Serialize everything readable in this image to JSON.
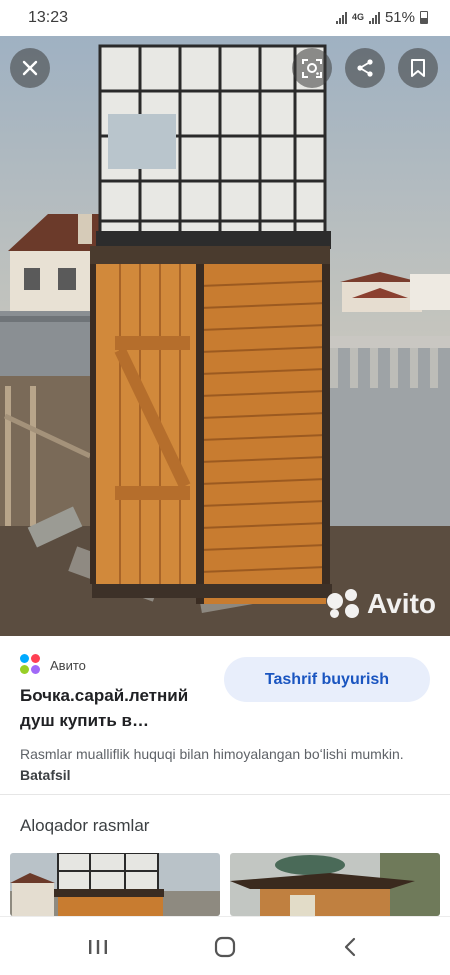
{
  "status": {
    "time": "13:23",
    "network": "4G",
    "battery": "51%"
  },
  "hero": {
    "watermark": "Avito",
    "buttons": {
      "close": "close-icon",
      "lens": "lens-icon",
      "share": "share-icon",
      "bookmark": "bookmark-icon"
    }
  },
  "result": {
    "source": "Авито",
    "title": "Бочка.сарай.летний душ купить в…",
    "visit_label": "Tashrif buyurish",
    "copyright_text": "Rasmlar mualliflik huquqi bilan himoyalangan boʻlishi mumkin.",
    "more_link": "Batafsil"
  },
  "related": {
    "heading": "Aloqador rasmlar"
  },
  "navbar": {
    "recents": "recents-icon",
    "home": "home-icon",
    "back": "back-icon"
  },
  "colors": {
    "accent": "#1a55c0",
    "button_bg": "#e8eefb",
    "wood": "#c0772c"
  }
}
